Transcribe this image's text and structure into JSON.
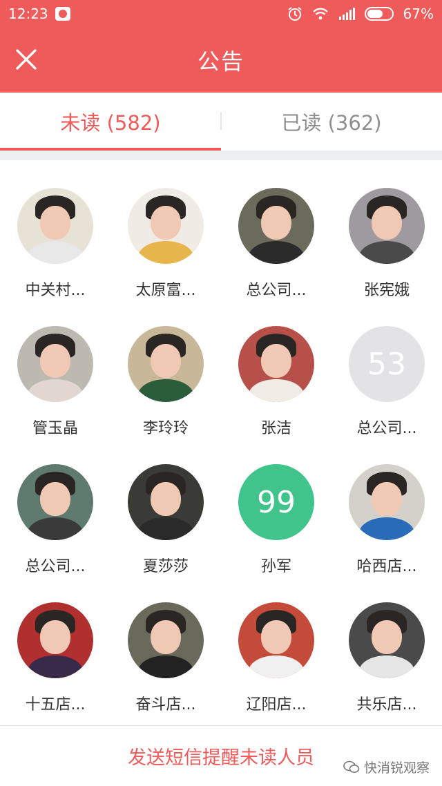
{
  "status_bar": {
    "time": "12:23",
    "battery": "67%"
  },
  "header": {
    "title": "公告"
  },
  "tabs": [
    {
      "label": "未读 (582)",
      "active": true
    },
    {
      "label": "已读 (362)",
      "active": false
    }
  ],
  "colors": {
    "accent": "#ef5a5a",
    "badge_gray": "#e3e3e6",
    "badge_green": "#41c48c"
  },
  "people": [
    {
      "name": "中关村...",
      "type": "photo",
      "bg": "#e8e2d6",
      "shirt": "#e8e8e8"
    },
    {
      "name": "太原富...",
      "type": "photo",
      "bg": "#f0ebe5",
      "shirt": "#e6b64c"
    },
    {
      "name": "总公司...",
      "type": "photo",
      "bg": "#6b6b5c",
      "shirt": "#2b2b2b"
    },
    {
      "name": "张宪娥",
      "type": "photo",
      "bg": "#9e9aa0",
      "shirt": "#4a4a4a"
    },
    {
      "name": "管玉晶",
      "type": "photo",
      "bg": "#bdb8b0",
      "shirt": "#e2d6d0"
    },
    {
      "name": "李玲玲",
      "type": "photo",
      "bg": "#c9b79a",
      "shirt": "#2a5d3a"
    },
    {
      "name": "张洁",
      "type": "photo",
      "bg": "#b8504a",
      "shirt": "#f1ece6"
    },
    {
      "name": "总公司...",
      "type": "badge",
      "badge": "53",
      "badge_color": "gray"
    },
    {
      "name": "总公司...",
      "type": "photo",
      "bg": "#5f7a6e",
      "shirt": "#3a3a3a"
    },
    {
      "name": "夏莎莎",
      "type": "photo",
      "bg": "#3a3a36",
      "shirt": "#2a2a2a"
    },
    {
      "name": "孙军",
      "type": "badge",
      "badge": "99",
      "badge_color": "green"
    },
    {
      "name": "哈西店...",
      "type": "photo",
      "bg": "#d4d0ca",
      "shirt": "#2b6cb8"
    },
    {
      "name": "十五店...",
      "type": "photo",
      "bg": "#b03030",
      "shirt": "#3a2a4a"
    },
    {
      "name": "奋斗店...",
      "type": "photo",
      "bg": "#6a6a5a",
      "shirt": "#222222"
    },
    {
      "name": "辽阳店...",
      "type": "photo",
      "bg": "#c44a3a",
      "shirt": "#f0f0f0"
    },
    {
      "name": "共乐店...",
      "type": "photo",
      "bg": "#4a4a4a",
      "shirt": "#e6e6e6"
    }
  ],
  "bottom": {
    "button_label": "发送短信提醒未读人员"
  },
  "watermark": {
    "text": "快消锐观察"
  }
}
